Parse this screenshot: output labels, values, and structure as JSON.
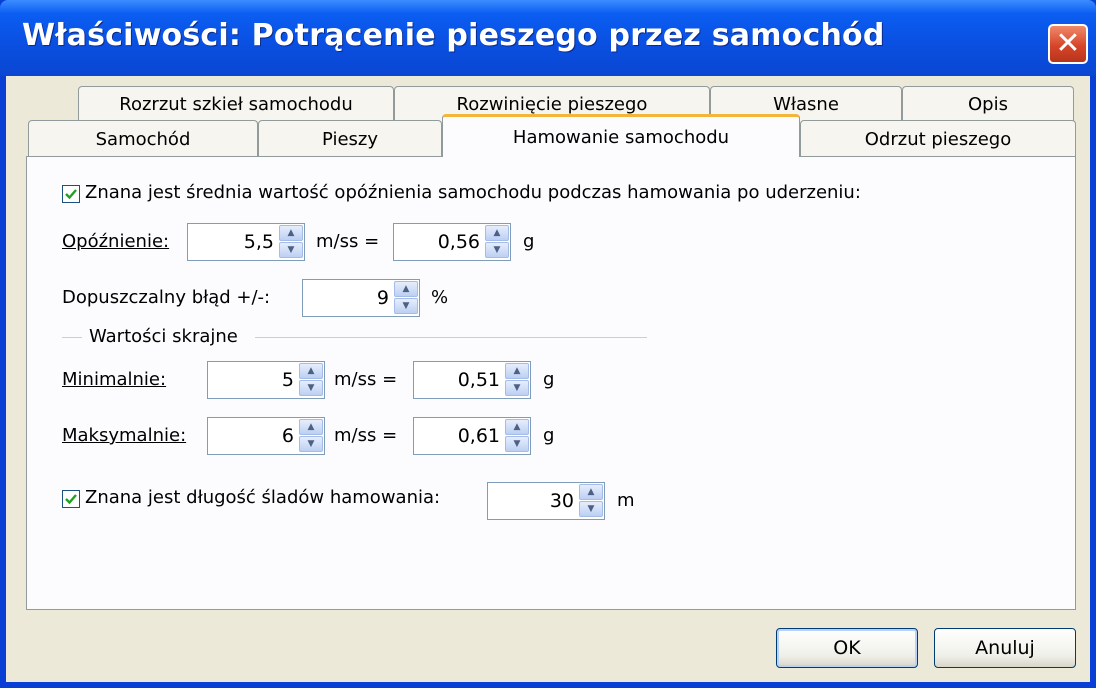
{
  "window": {
    "title": "Właściwości: Potrącenie pieszego przez samochód",
    "close_icon": "close-icon"
  },
  "tabs": {
    "row1": [
      "Rozrzut szkieł samochodu",
      "Rozwinięcie pieszego",
      "Własne",
      "Opis"
    ],
    "row2": [
      "Samochód",
      "Pieszy",
      "Hamowanie samochodu",
      "Odrzut pieszego"
    ],
    "active": "Hamowanie samochodu"
  },
  "form": {
    "known_decel_checkbox": {
      "checked": true,
      "label": "Znana jest średnia wartość opóźnienia samochodu podczas hamowania po uderzeniu:"
    },
    "deceleration": {
      "label": "Opóźnienie:",
      "value_mss": "5,5",
      "unit_mss": "m/ss =",
      "value_g": "0,56",
      "unit_g": "g"
    },
    "tolerance": {
      "label": "Dopuszczalny błąd +/-:",
      "value": "9",
      "unit": "%"
    },
    "extreme_group_label": "Wartości skrajne",
    "minimum": {
      "label": "Minimalnie:",
      "value_mss": "5",
      "unit_mss": "m/ss =",
      "value_g": "0,51",
      "unit_g": "g"
    },
    "maximum": {
      "label": "Maksymalnie:",
      "value_mss": "6",
      "unit_mss": "m/ss =",
      "value_g": "0,61",
      "unit_g": "g"
    },
    "skid_checkbox": {
      "checked": true,
      "label": "Znana jest długość śladów hamowania:"
    },
    "skid_length": {
      "value": "30",
      "unit": "m"
    }
  },
  "buttons": {
    "ok": "OK",
    "cancel": "Anuluj"
  }
}
